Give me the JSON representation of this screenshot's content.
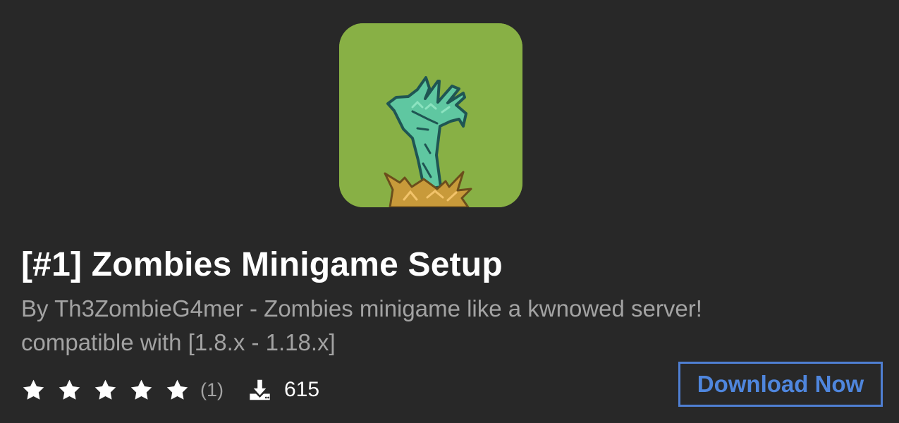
{
  "card": {
    "title": "[#1] Zombies Minigame Setup",
    "description_line1": "By Th3ZombieG4mer - Zombies minigame like a kwnowed server!",
    "description_line2": "compatible with [1.8.x - 1.18.x]"
  },
  "rating": {
    "stars_filled": 5,
    "stars_total": 5,
    "count_label": "(1)"
  },
  "downloads": {
    "count": "615"
  },
  "actions": {
    "download_button_label": "Download Now"
  },
  "icons": {
    "thumbnail": "zombie-hand-thumbnail",
    "star": "star-icon",
    "download": "download-icon"
  },
  "colors": {
    "background": "#282828",
    "thumbnail_green": "#88b045",
    "accent_blue": "#4f86dd",
    "muted_text": "#a3a3a3"
  }
}
